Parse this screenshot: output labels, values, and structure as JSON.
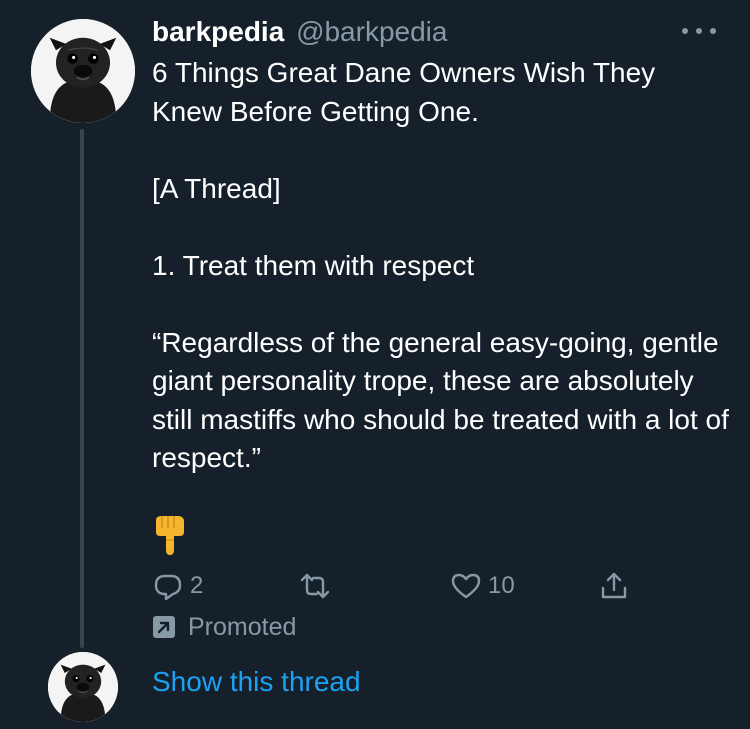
{
  "tweet": {
    "display_name": "barkpedia",
    "handle": "@barkpedia",
    "body": "6 Things Great Dane Owners Wish They Knew Before Getting One.\n\n[A Thread]\n\n1. Treat them with respect\n\n“Regardless of the general easy-going, gentle giant personality trope, these are absolutely still mastiffs who should be treated with a lot of respect.”",
    "emoji": "backhand-index-pointing-down",
    "actions": {
      "reply_icon": "reply-icon",
      "reply_count": "2",
      "retweet_icon": "retweet-icon",
      "like_icon": "heart-icon",
      "like_count": "10",
      "share_icon": "share-icon"
    },
    "promoted_label": "Promoted",
    "avatar": "pug-avatar"
  },
  "thread": {
    "show_thread_label": "Show this thread"
  },
  "colors": {
    "background": "#15202b",
    "text_primary": "#ffffff",
    "text_secondary": "#8899a6",
    "link": "#1da1f2",
    "thread_line": "#38444d"
  }
}
